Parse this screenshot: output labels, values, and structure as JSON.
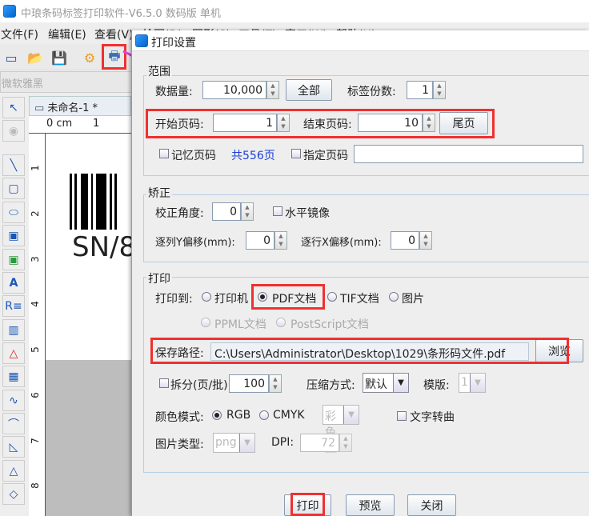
{
  "app": {
    "title": "中琅条码标签打印软件-V6.5.0 数码版 单机",
    "menu": [
      "文件(F)",
      "编辑(E)",
      "查看(V)",
      "绘图(D)",
      "图形(S)",
      "工具(T)",
      "窗口(W)",
      "帮助(H)"
    ],
    "font_name": "微软雅黑",
    "doc_tab": "未命名-1 *",
    "ruler_unit": "0 cm",
    "ruler_top_ticks": [
      "1"
    ],
    "ruler_left_ticks": [
      "1",
      "2",
      "3",
      "4",
      "5",
      "6",
      "7",
      "8"
    ],
    "barcode_text": "SN/8"
  },
  "dialog": {
    "title": "打印设置",
    "range": {
      "label": "范围",
      "data_count_label": "数据量:",
      "data_count": "10,000",
      "all_button": "全部",
      "copies_label": "标签份数:",
      "copies": "1",
      "start_page_label": "开始页码:",
      "start_page": "1",
      "end_page_label": "结束页码:",
      "end_page": "10",
      "last_page_button": "尾页",
      "remember_label": "记忆页码",
      "total_pages": "共556页",
      "specify_label": "指定页码",
      "specify_value": ""
    },
    "correction": {
      "label": "矫正",
      "angle_label": "校正角度:",
      "angle": "0",
      "mirror_label": "水平镜像",
      "col_y_label": "逐列Y偏移(mm):",
      "col_y": "0",
      "row_x_label": "逐行X偏移(mm):",
      "row_x": "0"
    },
    "print": {
      "label": "打印",
      "print_to_label": "打印到:",
      "options": [
        "打印机",
        "PDF文档",
        "TIF文档",
        "图片",
        "PPML文档",
        "PostScript文档"
      ],
      "selected": "PDF文档",
      "save_path_label": "保存路径:",
      "save_path": "C:\\Users\\Administrator\\Desktop\\1029\\条形码文件.pdf",
      "browse_button": "浏览",
      "split_label": "拆分(页/批):",
      "split_value": "100",
      "compress_label": "压缩方式:",
      "compress_value": "默认",
      "template_label": "模版:",
      "template_value": "1",
      "color_mode_label": "颜色模式:",
      "color_modes": [
        "RGB",
        "CMYK"
      ],
      "color_mode_selected": "RGB",
      "color_map": "彩色图",
      "text_curve_label": "文字转曲",
      "image_type_label": "图片类型:",
      "image_type": "png",
      "dpi_label": "DPI:",
      "dpi": "72"
    },
    "buttons": {
      "print": "打印",
      "preview": "预览",
      "close": "关闭"
    }
  },
  "colors": {
    "highlight": "#f03030",
    "arrow": "#e040e0",
    "link": "#1a3fd6"
  }
}
